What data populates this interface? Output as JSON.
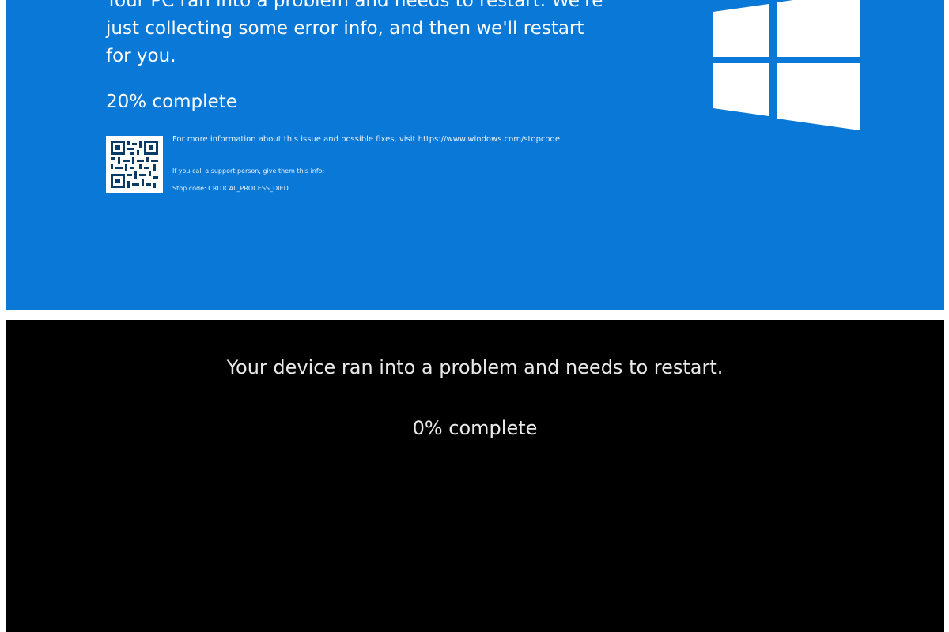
{
  "bsod": {
    "message": "Your PC ran into a problem and needs to restart. We're just collecting some error info, and then we'll restart for you.",
    "progress_text": "20% complete",
    "progress_value": 20,
    "more_info": "For more information about this issue and possible fixes, visit https://www.windows.com/stopcode",
    "support_text": "If you call a support person, give them this info:",
    "stop_code": "Stop code: CRITICAL_PROCESS_DIED",
    "background_color": "#0a78d7",
    "logo_icon": "windows-logo-icon",
    "qr_icon": "qr-code-icon"
  },
  "black_screen": {
    "message": "Your device ran into a problem and needs to restart.",
    "progress_text": "0% complete",
    "progress_value": 0,
    "background_color": "#000000"
  }
}
